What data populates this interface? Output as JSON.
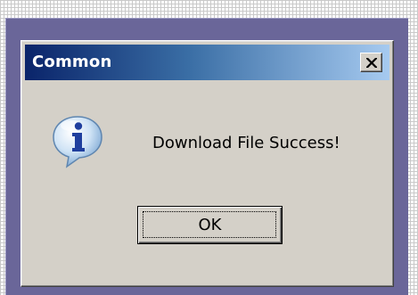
{
  "dialog": {
    "title": "Common",
    "message": "Download File Success!",
    "ok_label": "OK",
    "close_glyph": "X",
    "icon": "info-icon"
  },
  "colors": {
    "titlebar_start": "#0a246a",
    "titlebar_end": "#a6caf0",
    "dialog_face": "#d4d0c8",
    "backdrop": "#6a6699"
  }
}
